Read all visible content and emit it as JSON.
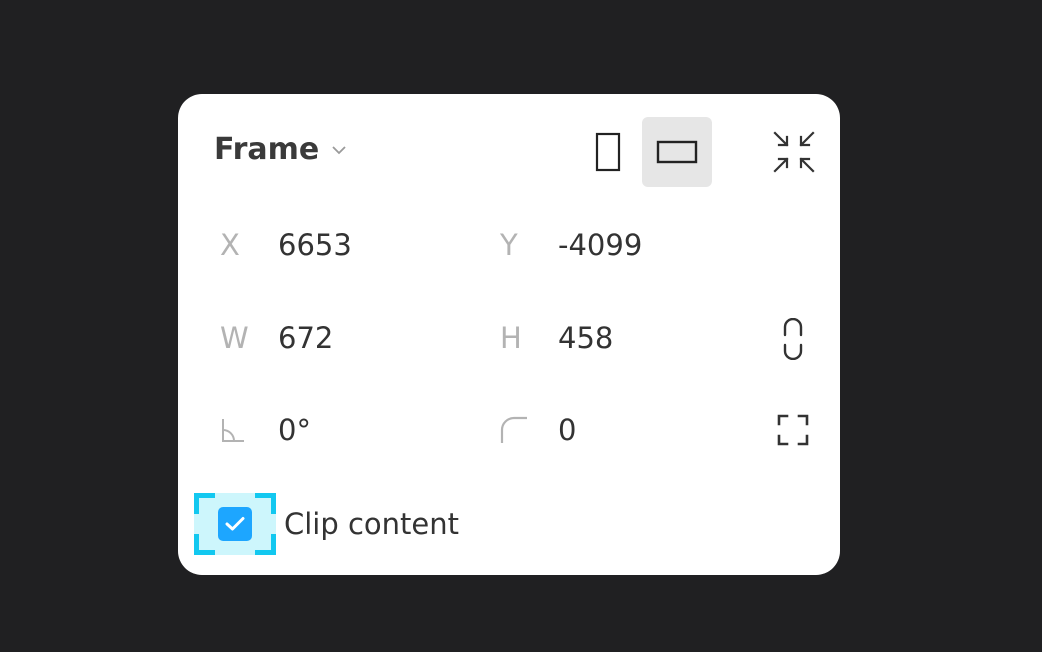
{
  "panel": {
    "title": "Frame",
    "orientation": {
      "selected": "landscape"
    },
    "fields": {
      "x": {
        "label": "X",
        "value": "6653"
      },
      "y": {
        "label": "Y",
        "value": "-4099"
      },
      "w": {
        "label": "W",
        "value": "672"
      },
      "h": {
        "label": "H",
        "value": "458"
      },
      "rotation": {
        "icon": "angle-icon",
        "value": "0°"
      },
      "corner_radius": {
        "icon": "corner-radius-icon",
        "value": "0"
      }
    },
    "clip_content": {
      "label": "Clip content",
      "checked": true
    }
  },
  "colors": {
    "background": "#202022",
    "panel": "#ffffff",
    "checkbox": "#1da6ff",
    "focus_highlight": "#cdf6fc",
    "focus_corners": "#12c8f0"
  }
}
